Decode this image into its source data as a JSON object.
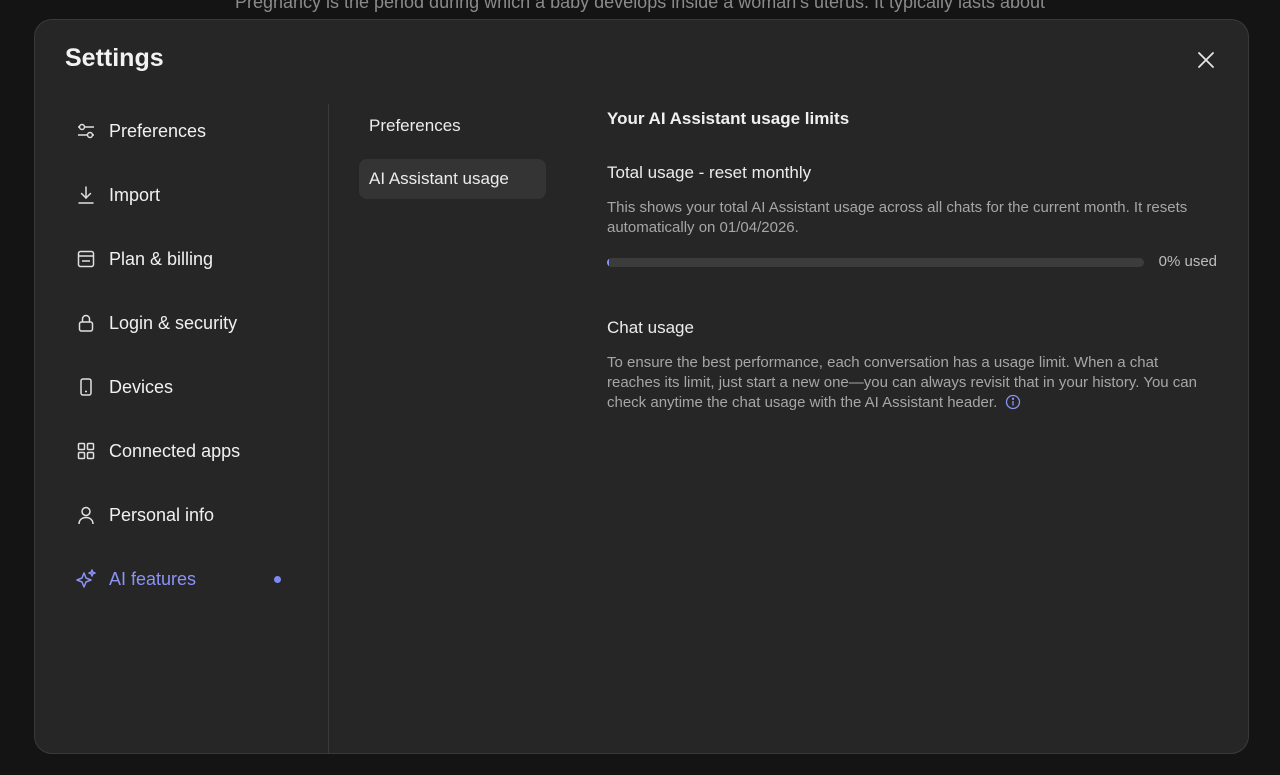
{
  "background": {
    "text": "Pregnancy is the period during which a baby develops inside a woman’s uterus. It typically lasts about"
  },
  "modal": {
    "title": "Settings",
    "close_icon": "close-icon"
  },
  "sidebar": {
    "items": [
      {
        "label": "Preferences",
        "icon": "sliders-icon"
      },
      {
        "label": "Import",
        "icon": "download-icon"
      },
      {
        "label": "Plan & billing",
        "icon": "billing-icon"
      },
      {
        "label": "Login & security",
        "icon": "lock-icon"
      },
      {
        "label": "Devices",
        "icon": "phone-icon"
      },
      {
        "label": "Connected apps",
        "icon": "grid-icon"
      },
      {
        "label": "Personal info",
        "icon": "user-icon"
      },
      {
        "label": "AI features",
        "icon": "sparkle-icon",
        "active": true
      }
    ]
  },
  "subnav": {
    "items": [
      {
        "label": "Preferences"
      },
      {
        "label": "AI Assistant usage",
        "active": true
      }
    ]
  },
  "content": {
    "title": "Your AI Assistant usage limits",
    "total": {
      "heading": "Total usage - reset monthly",
      "description": "This shows your total AI Assistant usage across all chats for the current month. It resets automatically on 01/04/2026.",
      "progress_fraction": 0,
      "progress_label": "0% used"
    },
    "chat": {
      "heading": "Chat usage",
      "description": "To ensure the best performance, each conversation has a usage limit. When a chat reaches its limit, just start a new one—you can always revisit that in your history. You can check anytime the chat usage with the AI Assistant header."
    }
  },
  "colors": {
    "accent": "#8b93f5",
    "panel": "#262626",
    "backdrop": "#141414"
  }
}
